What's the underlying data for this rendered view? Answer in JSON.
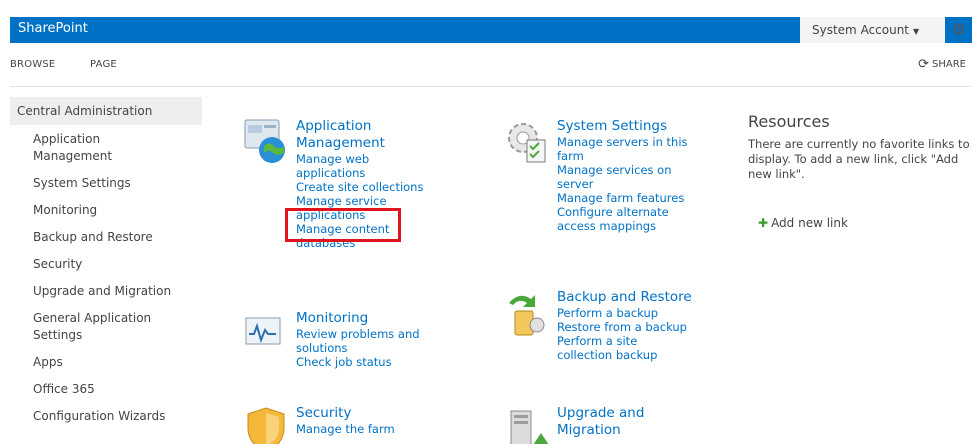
{
  "topbar": {
    "brand": "SharePoint",
    "account": "System Account",
    "gear_icon": "gear-icon"
  },
  "ribbon": {
    "tabs": [
      "BROWSE",
      "PAGE"
    ],
    "share": "SHARE"
  },
  "nav": {
    "header": "Central Administration",
    "items": [
      "Application Management",
      "System Settings",
      "Monitoring",
      "Backup and Restore",
      "Security",
      "Upgrade and Migration",
      "General Application Settings",
      "Apps",
      "Office 365",
      "Configuration Wizards"
    ]
  },
  "sections": {
    "app": {
      "title": "Application Management",
      "links": [
        "Manage web applications",
        "Create site collections",
        "Manage service applications",
        "Manage content databases"
      ]
    },
    "sys": {
      "title": "System Settings",
      "links": [
        "Manage servers in this farm",
        "Manage services on server",
        "Manage farm features",
        "Configure alternate access mappings"
      ]
    },
    "mon": {
      "title": "Monitoring",
      "links": [
        "Review problems and solutions",
        "Check job status"
      ]
    },
    "backup": {
      "title": "Backup and Restore",
      "links": [
        "Perform a backup",
        "Restore from a backup",
        "Perform a site collection backup"
      ]
    },
    "security": {
      "title": "Security",
      "links": [
        "Manage the farm"
      ]
    },
    "upgrade": {
      "title": "Upgrade and Migration"
    }
  },
  "resources": {
    "title": "Resources",
    "text": "There are currently no favorite links to display. To add a new link, click \"Add new link\".",
    "add_link": "Add new link"
  },
  "colors": {
    "brand_blue": "#0072c6",
    "link_blue": "#0072c6",
    "highlight_red": "#e0141c",
    "plus_green": "#3a9b26"
  }
}
